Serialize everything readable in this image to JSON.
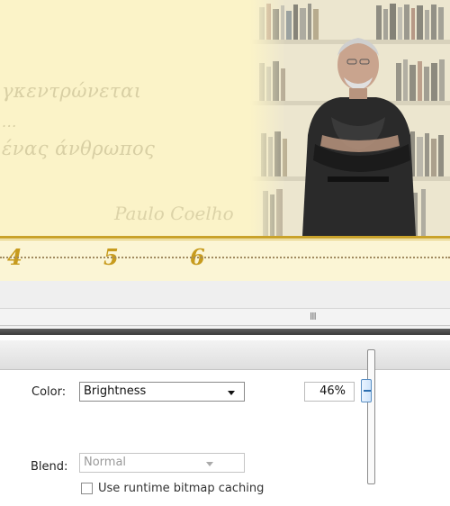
{
  "stage": {
    "quote_lines": [
      "γκεντρώνεται",
      "...",
      "ένας άνθρωπος"
    ],
    "signature": "Paulo Coelho"
  },
  "timeline": {
    "frame_numbers": [
      "4",
      "5",
      "6"
    ]
  },
  "scrollbar": {
    "grip": "III"
  },
  "properties": {
    "color_label": "Color:",
    "color_value": "Brightness",
    "percent_value": "46%",
    "brightness_percent": 46,
    "blend_label": "Blend:",
    "blend_value": "Normal",
    "cache_label": "Use runtime bitmap caching",
    "cache_checked": false
  },
  "colors": {
    "stage_bg": "#fbf3c8",
    "timeline_accent": "#c9a22a",
    "frame_number_color": "#c79b1e",
    "slider_thumb": "#5a8fc4"
  },
  "icons": {
    "dropdown_arrow": "chevron-down-icon",
    "slider": "slider-thumb-icon"
  }
}
